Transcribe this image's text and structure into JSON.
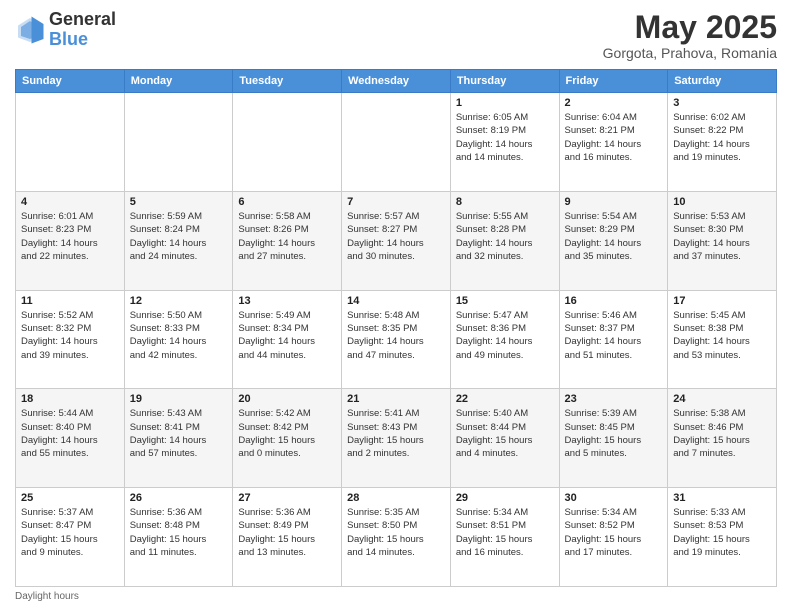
{
  "header": {
    "logo_line1": "General",
    "logo_line2": "Blue",
    "title": "May 2025",
    "subtitle": "Gorgota, Prahova, Romania"
  },
  "days": [
    "Sunday",
    "Monday",
    "Tuesday",
    "Wednesday",
    "Thursday",
    "Friday",
    "Saturday"
  ],
  "weeks": [
    [
      {
        "day": "",
        "info": ""
      },
      {
        "day": "",
        "info": ""
      },
      {
        "day": "",
        "info": ""
      },
      {
        "day": "",
        "info": ""
      },
      {
        "day": "1",
        "info": "Sunrise: 6:05 AM\nSunset: 8:19 PM\nDaylight: 14 hours\nand 14 minutes."
      },
      {
        "day": "2",
        "info": "Sunrise: 6:04 AM\nSunset: 8:21 PM\nDaylight: 14 hours\nand 16 minutes."
      },
      {
        "day": "3",
        "info": "Sunrise: 6:02 AM\nSunset: 8:22 PM\nDaylight: 14 hours\nand 19 minutes."
      }
    ],
    [
      {
        "day": "4",
        "info": "Sunrise: 6:01 AM\nSunset: 8:23 PM\nDaylight: 14 hours\nand 22 minutes."
      },
      {
        "day": "5",
        "info": "Sunrise: 5:59 AM\nSunset: 8:24 PM\nDaylight: 14 hours\nand 24 minutes."
      },
      {
        "day": "6",
        "info": "Sunrise: 5:58 AM\nSunset: 8:26 PM\nDaylight: 14 hours\nand 27 minutes."
      },
      {
        "day": "7",
        "info": "Sunrise: 5:57 AM\nSunset: 8:27 PM\nDaylight: 14 hours\nand 30 minutes."
      },
      {
        "day": "8",
        "info": "Sunrise: 5:55 AM\nSunset: 8:28 PM\nDaylight: 14 hours\nand 32 minutes."
      },
      {
        "day": "9",
        "info": "Sunrise: 5:54 AM\nSunset: 8:29 PM\nDaylight: 14 hours\nand 35 minutes."
      },
      {
        "day": "10",
        "info": "Sunrise: 5:53 AM\nSunset: 8:30 PM\nDaylight: 14 hours\nand 37 minutes."
      }
    ],
    [
      {
        "day": "11",
        "info": "Sunrise: 5:52 AM\nSunset: 8:32 PM\nDaylight: 14 hours\nand 39 minutes."
      },
      {
        "day": "12",
        "info": "Sunrise: 5:50 AM\nSunset: 8:33 PM\nDaylight: 14 hours\nand 42 minutes."
      },
      {
        "day": "13",
        "info": "Sunrise: 5:49 AM\nSunset: 8:34 PM\nDaylight: 14 hours\nand 44 minutes."
      },
      {
        "day": "14",
        "info": "Sunrise: 5:48 AM\nSunset: 8:35 PM\nDaylight: 14 hours\nand 47 minutes."
      },
      {
        "day": "15",
        "info": "Sunrise: 5:47 AM\nSunset: 8:36 PM\nDaylight: 14 hours\nand 49 minutes."
      },
      {
        "day": "16",
        "info": "Sunrise: 5:46 AM\nSunset: 8:37 PM\nDaylight: 14 hours\nand 51 minutes."
      },
      {
        "day": "17",
        "info": "Sunrise: 5:45 AM\nSunset: 8:38 PM\nDaylight: 14 hours\nand 53 minutes."
      }
    ],
    [
      {
        "day": "18",
        "info": "Sunrise: 5:44 AM\nSunset: 8:40 PM\nDaylight: 14 hours\nand 55 minutes."
      },
      {
        "day": "19",
        "info": "Sunrise: 5:43 AM\nSunset: 8:41 PM\nDaylight: 14 hours\nand 57 minutes."
      },
      {
        "day": "20",
        "info": "Sunrise: 5:42 AM\nSunset: 8:42 PM\nDaylight: 15 hours\nand 0 minutes."
      },
      {
        "day": "21",
        "info": "Sunrise: 5:41 AM\nSunset: 8:43 PM\nDaylight: 15 hours\nand 2 minutes."
      },
      {
        "day": "22",
        "info": "Sunrise: 5:40 AM\nSunset: 8:44 PM\nDaylight: 15 hours\nand 4 minutes."
      },
      {
        "day": "23",
        "info": "Sunrise: 5:39 AM\nSunset: 8:45 PM\nDaylight: 15 hours\nand 5 minutes."
      },
      {
        "day": "24",
        "info": "Sunrise: 5:38 AM\nSunset: 8:46 PM\nDaylight: 15 hours\nand 7 minutes."
      }
    ],
    [
      {
        "day": "25",
        "info": "Sunrise: 5:37 AM\nSunset: 8:47 PM\nDaylight: 15 hours\nand 9 minutes."
      },
      {
        "day": "26",
        "info": "Sunrise: 5:36 AM\nSunset: 8:48 PM\nDaylight: 15 hours\nand 11 minutes."
      },
      {
        "day": "27",
        "info": "Sunrise: 5:36 AM\nSunset: 8:49 PM\nDaylight: 15 hours\nand 13 minutes."
      },
      {
        "day": "28",
        "info": "Sunrise: 5:35 AM\nSunset: 8:50 PM\nDaylight: 15 hours\nand 14 minutes."
      },
      {
        "day": "29",
        "info": "Sunrise: 5:34 AM\nSunset: 8:51 PM\nDaylight: 15 hours\nand 16 minutes."
      },
      {
        "day": "30",
        "info": "Sunrise: 5:34 AM\nSunset: 8:52 PM\nDaylight: 15 hours\nand 17 minutes."
      },
      {
        "day": "31",
        "info": "Sunrise: 5:33 AM\nSunset: 8:53 PM\nDaylight: 15 hours\nand 19 minutes."
      }
    ]
  ],
  "footer": {
    "text": "Daylight hours"
  }
}
